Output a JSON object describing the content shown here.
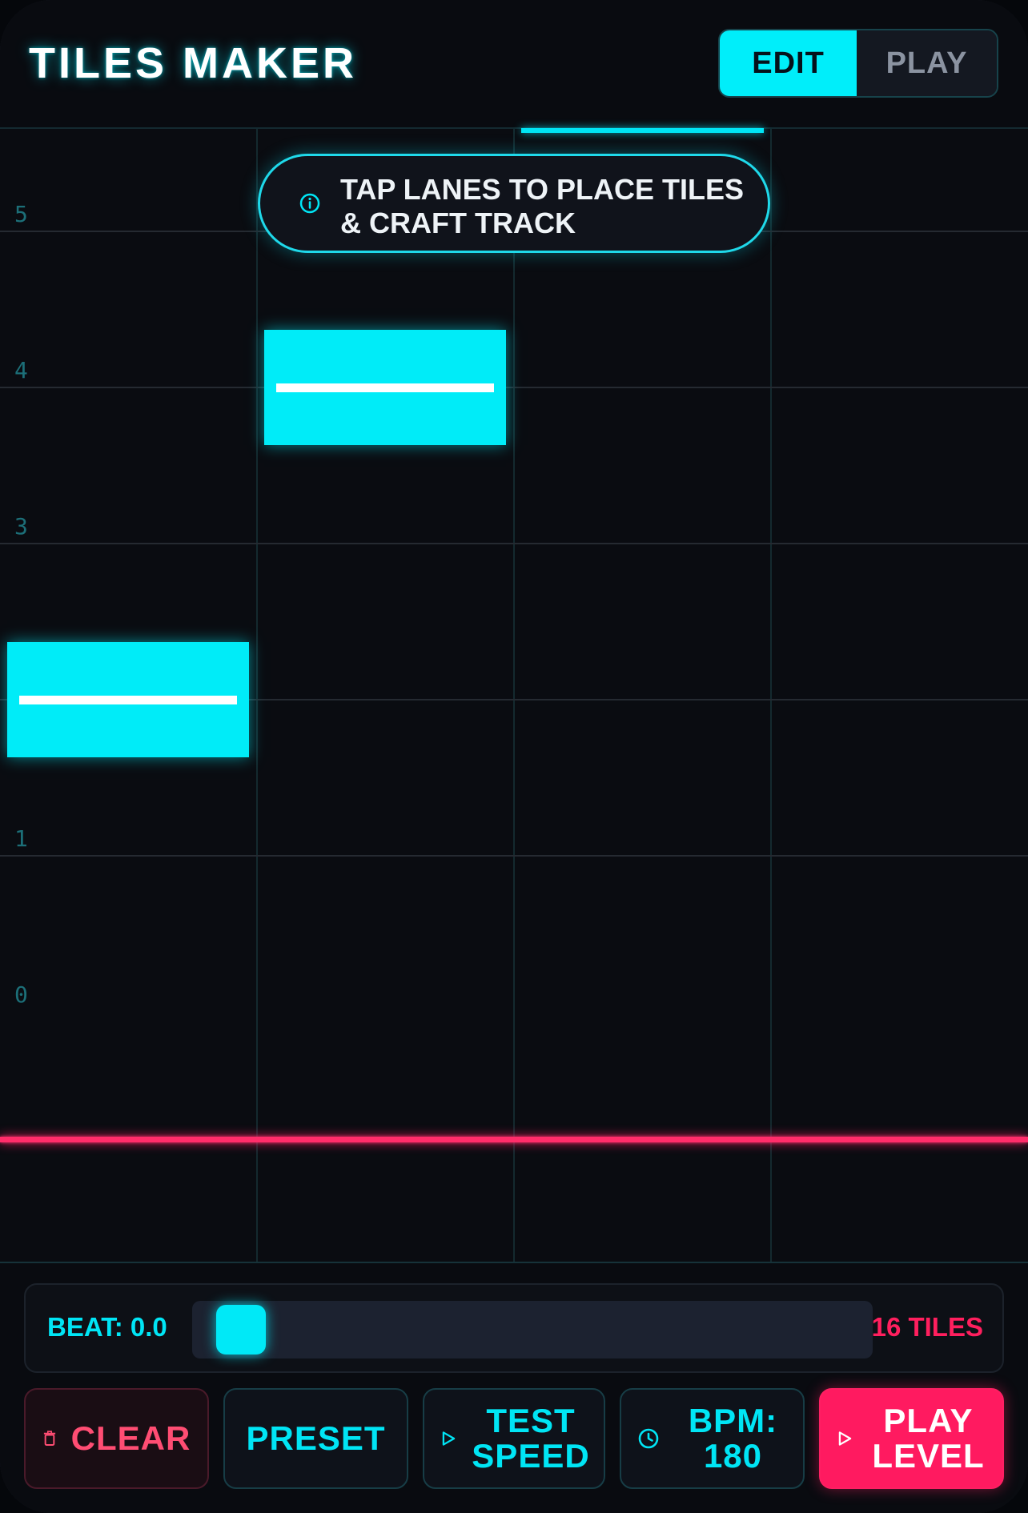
{
  "header": {
    "title": "TILES MAKER",
    "mode_toggle": {
      "edit_label": "EDIT",
      "play_label": "PLAY",
      "active": "EDIT"
    }
  },
  "hint": {
    "icon": "info-icon",
    "text": "TAP LANES TO PLACE TILES & CRAFT TRACK"
  },
  "track": {
    "lanes": 4,
    "beat_labels": [
      "5",
      "4",
      "3",
      "1",
      "0"
    ],
    "tiles": [
      {
        "lane": 1,
        "beat": 4
      },
      {
        "lane": 0,
        "beat": 2
      }
    ],
    "colors": {
      "tile": "#00ecf8",
      "hit_line": "#ff2d6a",
      "accent": "#00e5f5"
    }
  },
  "footer": {
    "beat_readout": "BEAT: 0.0",
    "beat_progress": 0.0,
    "tile_count": "16 TILES",
    "buttons": {
      "clear": {
        "label": "CLEAR",
        "icon": "trash-icon"
      },
      "preset": {
        "label": "PRESET"
      },
      "test_speed": {
        "label": "TEST SPEED",
        "icon": "play-outline-icon"
      },
      "bpm": {
        "label": "BPM: 180",
        "icon": "clock-icon"
      },
      "play_level": {
        "label": "PLAY LEVEL",
        "icon": "play-outline-icon"
      }
    }
  }
}
